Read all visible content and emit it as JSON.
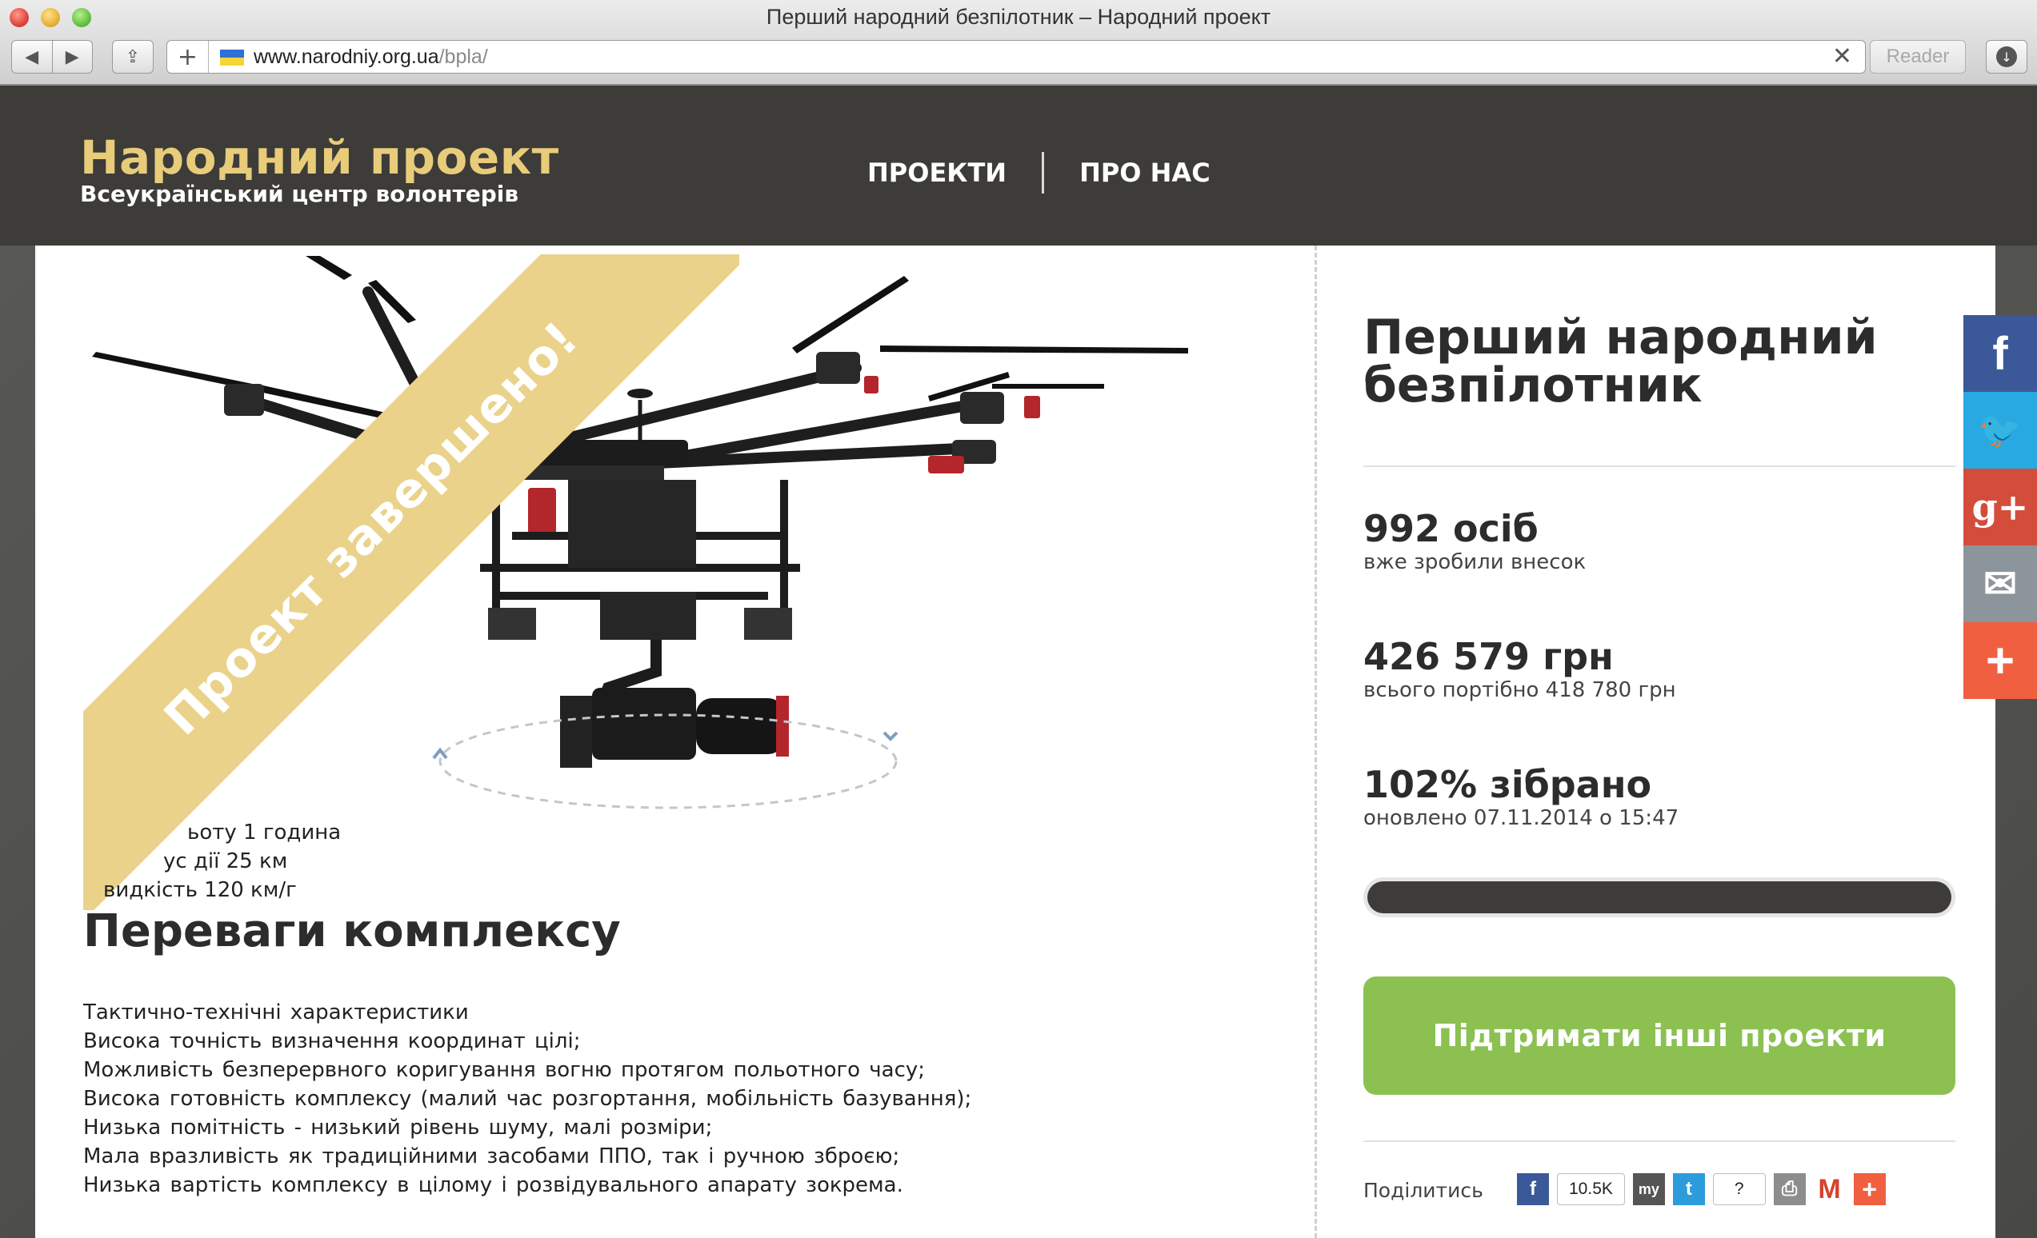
{
  "browser": {
    "window_title": "Перший народний безпілотник – Народний проект",
    "url_host": "www.narodniy.org.ua",
    "url_path": "/bpla/",
    "reader_label": "Reader",
    "nav_back_glyph": "◀",
    "nav_forward_glyph": "▶",
    "share_glyph": "⇪",
    "add_glyph": "+",
    "clear_glyph": "✕",
    "download_glyph": "↓",
    "icons": [
      "back-icon",
      "forward-icon",
      "share-icon",
      "add-bookmark-icon",
      "ukraine-flag-icon",
      "clear-icon",
      "download-icon"
    ]
  },
  "header": {
    "logo_title": "Народний проект",
    "logo_subtitle": "Всеукраїнський центр волонтерів",
    "nav": [
      "ПРОЕКТИ",
      "ПРО НАС"
    ],
    "bg_color": "#3d3c39",
    "logo_color": "#e8cc7a"
  },
  "hero": {
    "ribbon_text": "Проект завершено!",
    "ribbon_color": "#ead28a",
    "specs": [
      "ьоту 1 година",
      "ус дії 25 км",
      "видкість 120 км/г"
    ]
  },
  "advantages": {
    "title": "Переваги комплексу",
    "lines": [
      "Тактично-технічні характеристики",
      "Висока точність визначення координат цілі;",
      "Можливість безперервного коригування вогню протягом польотного часу;",
      "Висока готовність комплексу (малий час розгортання, мобільність базування);",
      "Низька помітність - низький рівень шуму, малі розміри;",
      "Мала вразливість як традиційними засобами ППО, так і ручною зброєю;",
      "Низька вартість комплексу в цілому і розвідувального апарату зокрема."
    ]
  },
  "project": {
    "title_line1": "Перший народний",
    "title_line2": "безпілотник",
    "contributors": "992 осіб",
    "contributors_label": "вже зробили внесок",
    "raised": "426 579 грн",
    "needed": "всього портібно 418 780 грн",
    "percent_text": "102% зібрано",
    "updated": "оновлено 07.11.2014 о 15:47",
    "progress_fraction": 1.0,
    "support_button": "Підтримати інші проекти",
    "support_color": "#8cc152"
  },
  "share": {
    "label": "Поділитись",
    "fb_count": "10.5K",
    "tw_count": "?",
    "my_label": "my",
    "fb_glyph": "f",
    "tw_glyph": "t",
    "gmail_glyph": "M",
    "plus_glyph": "+",
    "print_glyph": "⎙",
    "icons": [
      "facebook-icon",
      "mymail-icon",
      "twitter-icon",
      "print-icon",
      "gmail-icon",
      "more-icon"
    ]
  },
  "social_bar": {
    "items": [
      {
        "name": "facebook",
        "glyph": "f",
        "color": "#3b5998"
      },
      {
        "name": "twitter",
        "glyph": "🐦",
        "color": "#29a9e1"
      },
      {
        "name": "google-plus",
        "glyph": "g+",
        "color": "#d44d3b"
      },
      {
        "name": "email",
        "glyph": "✉",
        "color": "#8c959b"
      },
      {
        "name": "more",
        "glyph": "+",
        "color": "#f05f40"
      }
    ]
  }
}
